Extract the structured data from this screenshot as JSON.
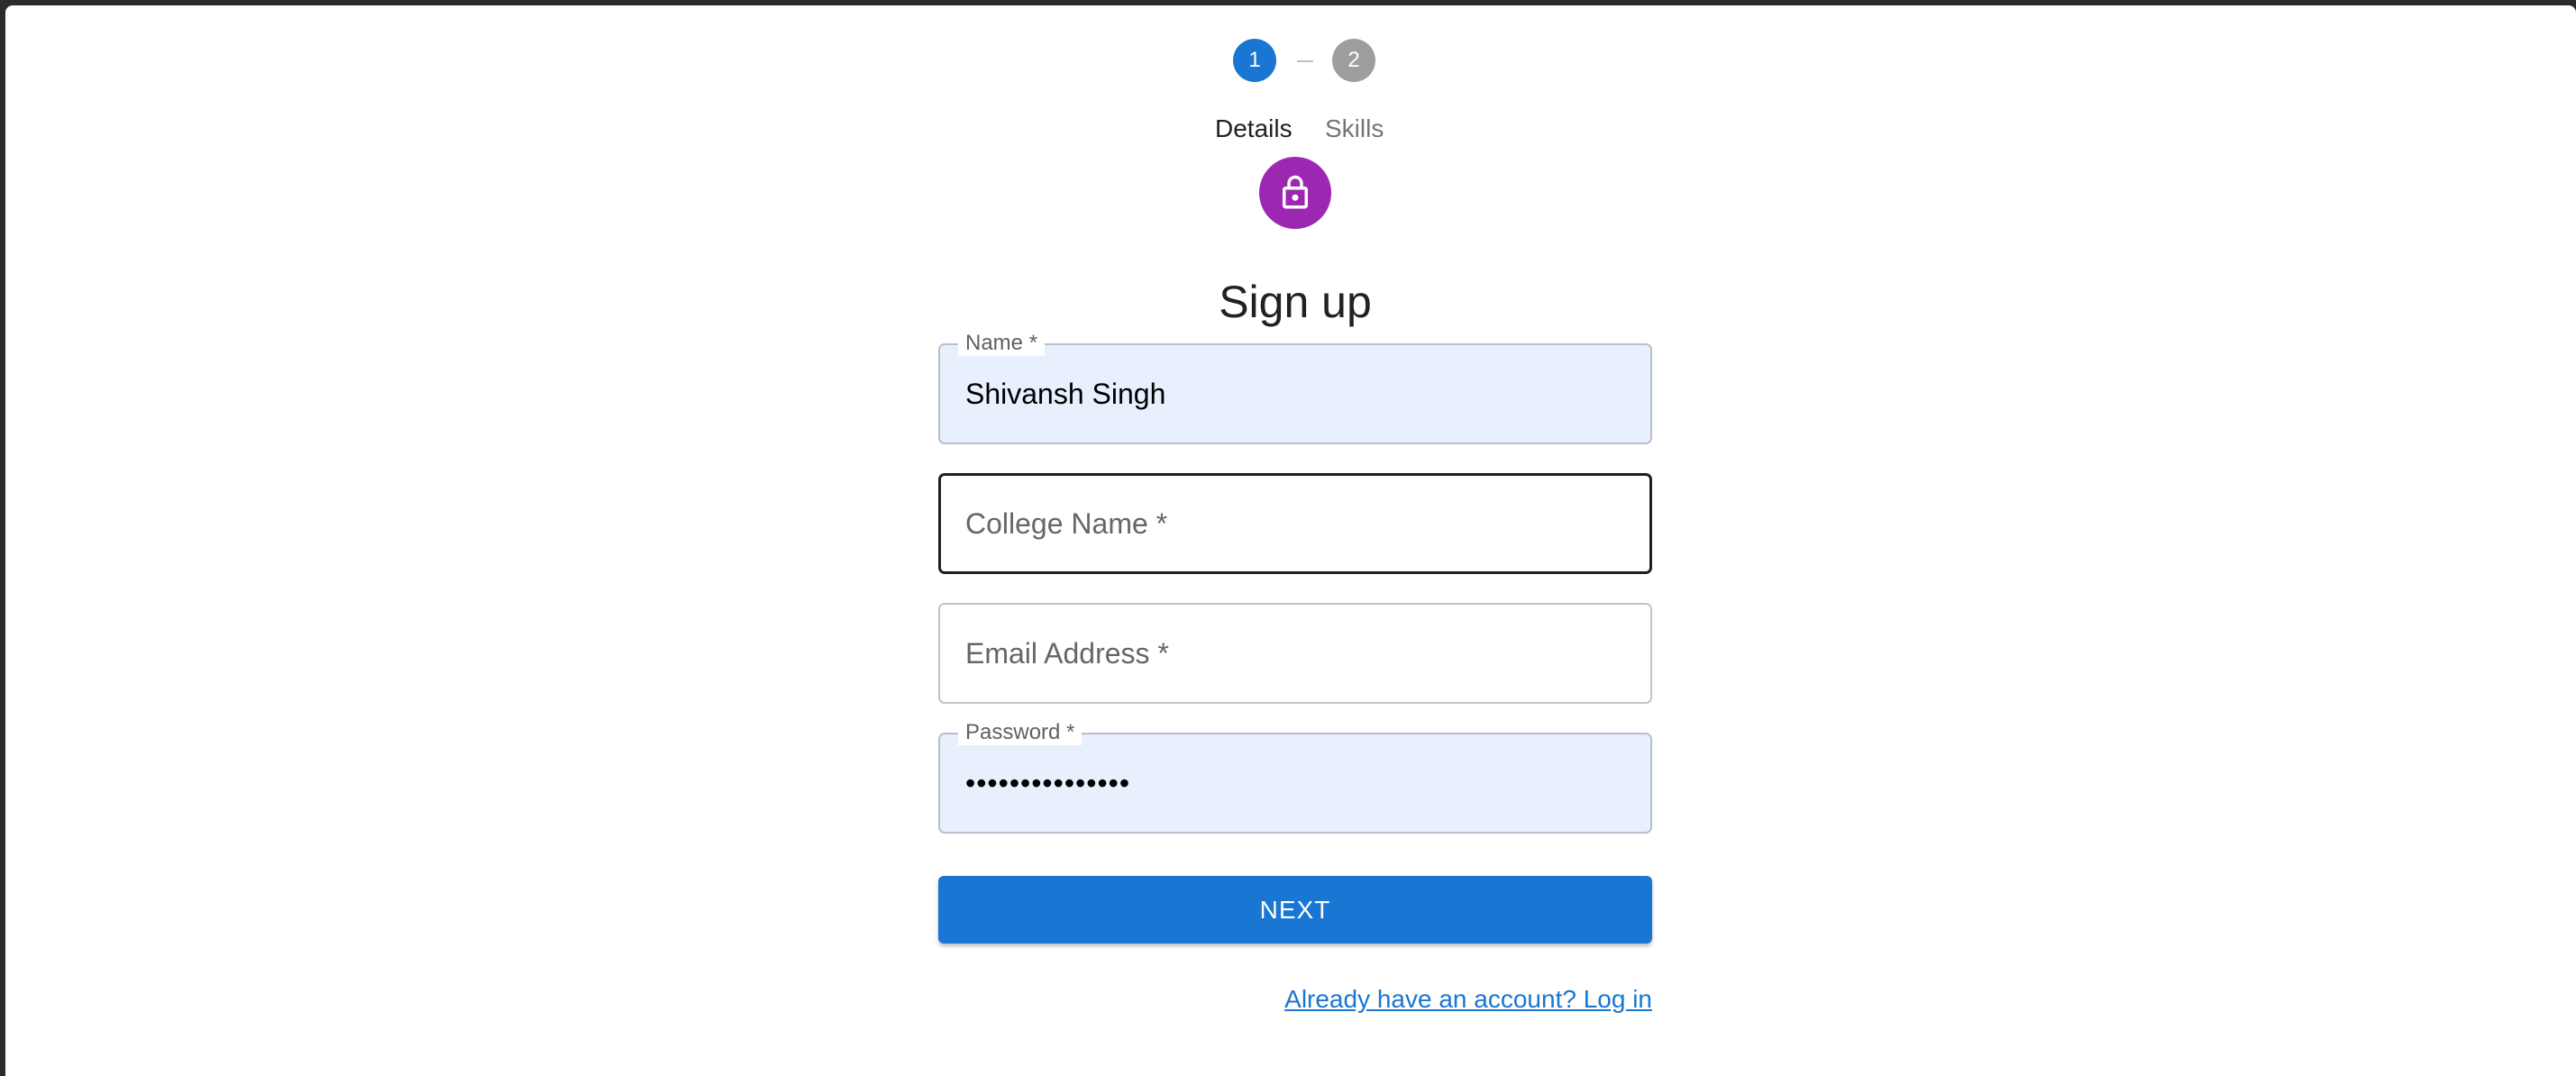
{
  "stepper": {
    "steps": [
      {
        "number": "1",
        "label": "Details",
        "state": "active"
      },
      {
        "number": "2",
        "label": "Skills",
        "state": "inactive"
      }
    ],
    "active_color": "#1976d2",
    "inactive_color": "#9e9e9e"
  },
  "avatar": {
    "icon": "lock-icon",
    "color": "#9c27b0"
  },
  "title": "Sign up",
  "fields": {
    "name": {
      "label": "Name *",
      "value": "Shivansh Singh"
    },
    "college": {
      "placeholder": "College Name *",
      "value": ""
    },
    "email": {
      "placeholder": "Email Address *",
      "value": ""
    },
    "password": {
      "label": "Password *",
      "value": "•••••••••••••••"
    }
  },
  "actions": {
    "next_label": "NEXT",
    "login_link": "Already have an account? Log in"
  },
  "colors": {
    "primary": "#1976d2",
    "autofill_background": "#e8f0fe"
  }
}
